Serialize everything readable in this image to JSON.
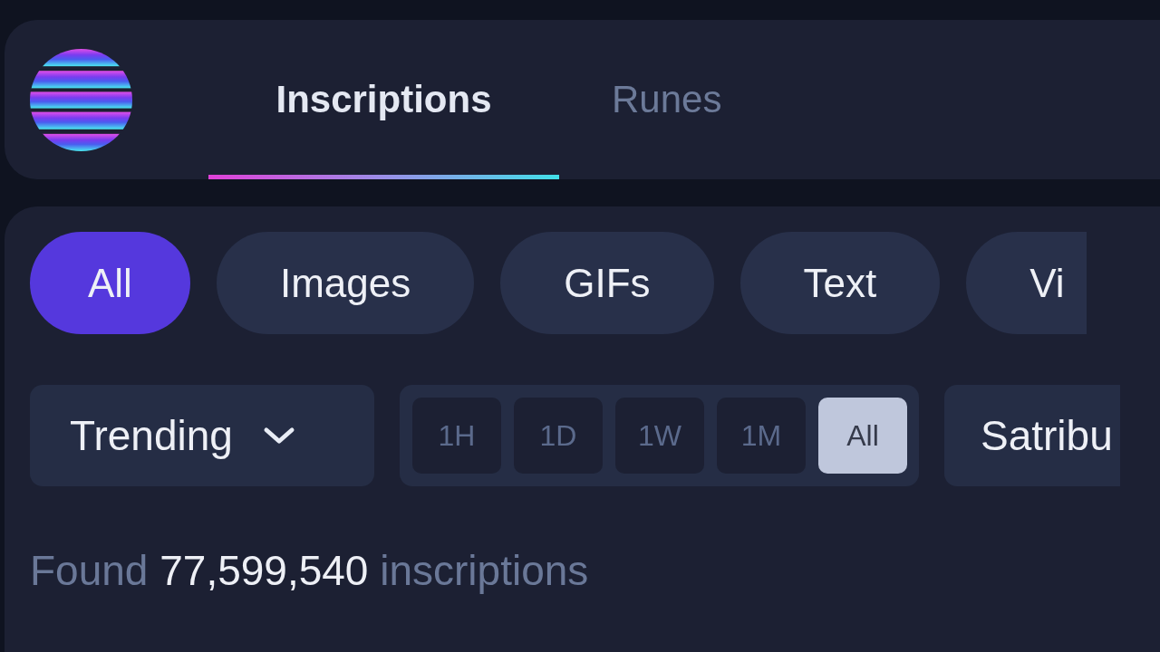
{
  "tabs": [
    {
      "label": "Inscriptions",
      "selected": true
    },
    {
      "label": "Runes",
      "selected": false
    }
  ],
  "type_filters": [
    {
      "label": "All",
      "selected": true
    },
    {
      "label": "Images",
      "selected": false
    },
    {
      "label": "GIFs",
      "selected": false
    },
    {
      "label": "Text",
      "selected": false
    },
    {
      "label": "Vi",
      "selected": false
    }
  ],
  "sort_dropdown": {
    "value": "Trending"
  },
  "time_ranges": [
    {
      "label": "1H",
      "selected": false
    },
    {
      "label": "1D",
      "selected": false
    },
    {
      "label": "1W",
      "selected": false
    },
    {
      "label": "1M",
      "selected": false
    },
    {
      "label": "All",
      "selected": true
    }
  ],
  "source_dropdown": {
    "value": "Satribu"
  },
  "results": {
    "prefix": "Found",
    "count": "77,599,540",
    "suffix": "inscriptions"
  }
}
